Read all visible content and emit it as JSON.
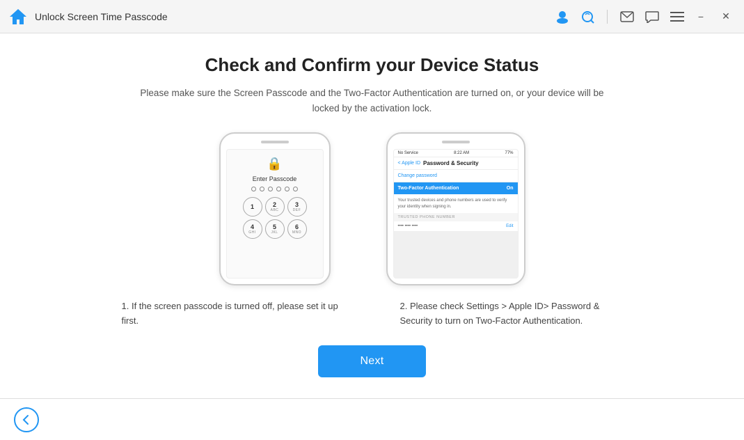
{
  "titlebar": {
    "title": "Unlock Screen Time Passcode",
    "logo_icon": "home-icon"
  },
  "header": {
    "title": "Check and Confirm your Device Status",
    "subtitle": "Please make sure the Screen Passcode and the Two-Factor Authentication are turned on, or your device will be locked by the activation lock."
  },
  "phone1": {
    "enter_passcode": "Enter Passcode",
    "keypad": [
      [
        "1",
        "",
        "2",
        "ABC",
        "3",
        "DEF"
      ],
      [
        "4",
        "GHI",
        "5",
        "JKL",
        "6",
        "MNO"
      ]
    ]
  },
  "phone2": {
    "status": {
      "carrier": "No Service",
      "time": "8:22 AM",
      "battery": "77%"
    },
    "nav": {
      "back": "< Apple ID",
      "title": "Password & Security"
    },
    "change_password": "Change password",
    "two_factor_label": "Two-Factor Authentication",
    "two_factor_value": "On",
    "desc": "Your trusted devices and phone numbers are used to verify your identity when signing in.",
    "trusted_label": "TRUSTED PHONE NUMBER",
    "trusted_edit": "Edit"
  },
  "descriptions": {
    "item1": "1. If the screen passcode is turned off, please set it up first.",
    "item2": "2. Please check Settings > Apple ID> Password & Security to turn on Two-Factor Authentication."
  },
  "buttons": {
    "next": "Next",
    "back_icon": "back-arrow-icon"
  }
}
